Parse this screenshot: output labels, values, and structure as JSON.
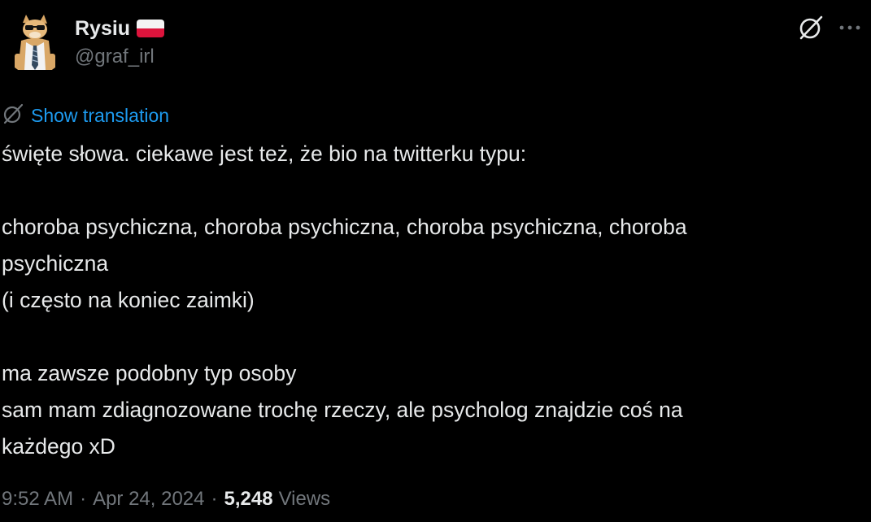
{
  "author": {
    "display_name": "Rysiu",
    "handle": "@graf_irl",
    "flag": "poland-flag",
    "avatar": "dog-in-suit-sunglasses-avatar"
  },
  "actions": {
    "grok_icon": "grok-icon",
    "more_icon": "more-options-icon"
  },
  "translation": {
    "label": "Show translation",
    "icon": "grok-icon"
  },
  "tweet": {
    "lines": [
      "święte słowa. ciekawe jest też, że bio na twitterku typu:",
      "",
      "choroba psychiczna, choroba psychiczna, choroba psychiczna, choroba",
      "psychiczna",
      "(i często na koniec zaimki)",
      "",
      "ma zawsze podobny typ osoby",
      "sam mam zdiagnozowane trochę rzeczy, ale psycholog znajdzie coś na",
      "każdego xD"
    ]
  },
  "meta": {
    "time": "9:52 AM",
    "separator": "·",
    "date": "Apr 24, 2024",
    "views_count": "5,248",
    "views_label": "Views"
  },
  "colors": {
    "background": "#000000",
    "text": "#e7e9ea",
    "muted": "#71767b",
    "link": "#1d9bf0"
  }
}
